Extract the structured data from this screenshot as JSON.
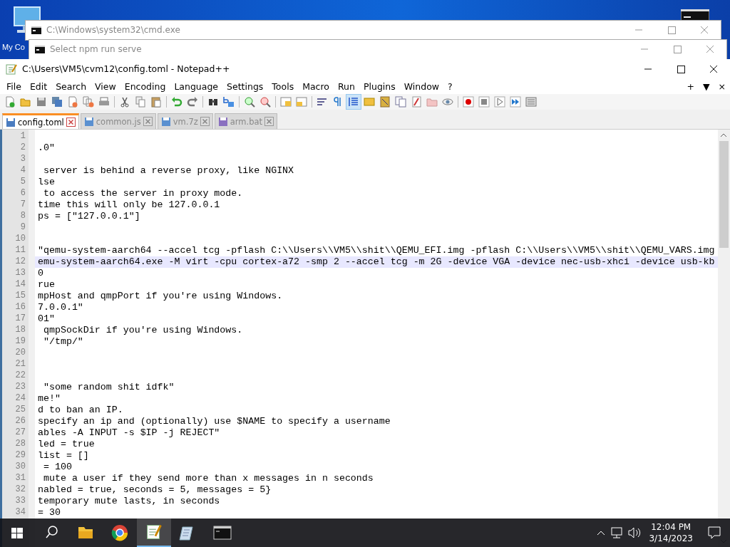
{
  "desktop": {
    "icon_label": "My Co"
  },
  "windows": [
    {
      "title": "C:\\Windows\\system32\\cmd.exe",
      "active": false
    },
    {
      "title": "Select npm run serve",
      "active": false
    }
  ],
  "notepad": {
    "title": "C:\\Users\\VM5\\cvm12\\config.toml - Notepad++",
    "active": true,
    "menu": [
      "File",
      "Edit",
      "Search",
      "View",
      "Encoding",
      "Language",
      "Settings",
      "Tools",
      "Macro",
      "Run",
      "Plugins",
      "Window",
      "?"
    ],
    "menu_right": [
      "+",
      "▼",
      "×"
    ],
    "toolbar": [
      {
        "kind": "new"
      },
      {
        "kind": "open"
      },
      {
        "kind": "save"
      },
      {
        "kind": "saveall"
      },
      {
        "kind": "close"
      },
      {
        "kind": "closeall"
      },
      {
        "kind": "print"
      },
      {
        "kind": "sep"
      },
      {
        "kind": "cut"
      },
      {
        "kind": "copy"
      },
      {
        "kind": "paste"
      },
      {
        "kind": "sep"
      },
      {
        "kind": "undo"
      },
      {
        "kind": "redo"
      },
      {
        "kind": "sep"
      },
      {
        "kind": "find"
      },
      {
        "kind": "replace"
      },
      {
        "kind": "sep"
      },
      {
        "kind": "zoomin"
      },
      {
        "kind": "zoomout"
      },
      {
        "kind": "sep"
      },
      {
        "kind": "sync"
      },
      {
        "kind": "synch"
      },
      {
        "kind": "sep"
      },
      {
        "kind": "wrap"
      },
      {
        "kind": "pilcrow"
      },
      {
        "kind": "indent",
        "selected": true
      },
      {
        "kind": "doc"
      },
      {
        "kind": "map"
      },
      {
        "kind": "list"
      },
      {
        "kind": "func"
      },
      {
        "kind": "folder"
      },
      {
        "kind": "eye"
      },
      {
        "kind": "sep"
      },
      {
        "kind": "record"
      },
      {
        "kind": "stop"
      },
      {
        "kind": "play"
      },
      {
        "kind": "playmulti"
      },
      {
        "kind": "savemacro"
      }
    ],
    "tabs": [
      {
        "label": "config.toml",
        "selected": true
      },
      {
        "label": "common.js",
        "selected": false
      },
      {
        "label": "vm.7z",
        "selected": false
      },
      {
        "label": "arm.bat",
        "selected": false
      }
    ],
    "lines": [
      {
        "number": "1",
        "current": false
      },
      {
        "number": "2",
        "text": ".0\"",
        "current": false
      },
      {
        "number": "3",
        "current": false
      },
      {
        "number": "4",
        "text": " server is behind a reverse proxy, like NGINX",
        "current": false
      },
      {
        "number": "5",
        "text": "lse",
        "current": false
      },
      {
        "number": "6",
        "text": " to access the server in proxy mode.",
        "current": false
      },
      {
        "number": "7",
        "text": "time this will only be 127.0.0.1",
        "current": false
      },
      {
        "number": "8",
        "text": "ps = [\"127.0.0.1\"]",
        "current": false
      },
      {
        "number": "9",
        "current": false
      },
      {
        "number": "10",
        "current": false
      },
      {
        "number": "11",
        "text": "\"qemu-system-aarch64 --accel tcg -pflash C:\\\\Users\\\\VM5\\\\shit\\\\QEMU_EFI.img -pflash C:\\\\Users\\\\VM5\\\\shit\\\\QEMU_VARS.img",
        "current": false
      },
      {
        "number": "12",
        "text": "emu-system-aarch64.exe -M virt -cpu cortex-a72 -smp 2 --accel tcg -m 2G -device VGA -device nec-usb-xhci -device usb-kb",
        "current": true
      },
      {
        "number": "13",
        "text": "0",
        "current": false
      },
      {
        "number": "14",
        "text": "rue",
        "current": false
      },
      {
        "number": "15",
        "text": "mpHost and qmpPort if you're using Windows.",
        "current": false
      },
      {
        "number": "16",
        "text": "7.0.0.1\"",
        "current": false
      },
      {
        "number": "17",
        "text": "01\"",
        "current": false
      },
      {
        "number": "18",
        "text": " qmpSockDir if you're using Windows.",
        "current": false
      },
      {
        "number": "19",
        "text": " \"/tmp/\"",
        "current": false
      },
      {
        "number": "20",
        "current": false
      },
      {
        "number": "21",
        "current": false
      },
      {
        "number": "22",
        "current": false
      },
      {
        "number": "23",
        "text": " \"some random shit idfk\"",
        "current": false
      },
      {
        "number": "24",
        "text": "me!\"",
        "current": false
      },
      {
        "number": "25",
        "text": "d to ban an IP.",
        "current": false
      },
      {
        "number": "26",
        "text": "specify an ip and (optionally) use $NAME to specify a username",
        "current": false
      },
      {
        "number": "27",
        "text": "ables -A INPUT -s $IP -j REJECT\"",
        "current": false
      },
      {
        "number": "28",
        "text": "led = true",
        "current": false
      },
      {
        "number": "29",
        "text": "list = []",
        "current": false
      },
      {
        "number": "30",
        "text": " = 100",
        "current": false
      },
      {
        "number": "31",
        "text": " mute a user if they send more than x messages in n seconds",
        "current": false
      },
      {
        "number": "32",
        "text": "nabled = true, seconds = 5, messages = 5}",
        "current": false
      },
      {
        "number": "33",
        "text": "temporary mute lasts, in seconds",
        "current": false
      },
      {
        "number": "34",
        "text": "= 30",
        "current": false
      }
    ]
  },
  "taskbar": {
    "apps": [
      {
        "kind": "explorer",
        "active": false
      },
      {
        "kind": "chrome",
        "active": false
      },
      {
        "kind": "notepadpp",
        "active": true
      },
      {
        "kind": "notepad",
        "active": false
      },
      {
        "kind": "cmd",
        "active": false
      }
    ],
    "time": "12:04 PM",
    "date": "3/14/2023"
  }
}
